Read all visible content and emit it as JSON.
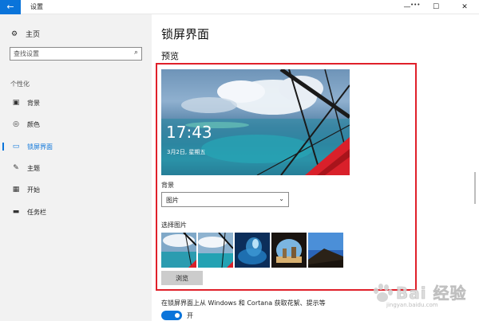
{
  "window": {
    "title": "设置",
    "back_icon": "back-arrow-icon",
    "controls": {
      "minimize": "—",
      "maximize": "☐",
      "close": "✕",
      "extra": "•••"
    }
  },
  "sidebar": {
    "home": {
      "label": "主页",
      "icon": "gear-icon"
    },
    "search": {
      "placeholder": "查找设置",
      "icon": "search-icon"
    },
    "section": "个性化",
    "items": [
      {
        "label": "背景",
        "icon": "image-icon",
        "active": false
      },
      {
        "label": "颜色",
        "icon": "palette-icon",
        "active": false
      },
      {
        "label": "锁屏界面",
        "icon": "lock-screen-icon",
        "active": true
      },
      {
        "label": "主题",
        "icon": "brush-icon",
        "active": false
      },
      {
        "label": "开始",
        "icon": "start-icon",
        "active": false
      },
      {
        "label": "任务栏",
        "icon": "taskbar-icon",
        "active": false
      }
    ]
  },
  "main": {
    "title": "锁屏界面",
    "preview_label": "预览",
    "lock_time": "17:43",
    "lock_date": "3月2日, 星期五",
    "background": {
      "label": "背景",
      "selected": "图片"
    },
    "choose_label": "选择图片",
    "browse_label": "浏览",
    "cortana_text": "在锁屏界面上从 Windows 和 Cortana 获取花絮、提示等",
    "toggle": {
      "state": "开",
      "on": true
    }
  },
  "watermark": {
    "text": "Bai 经验",
    "url": "jingyan.baidu.com"
  },
  "colors": {
    "accent": "#0a74da",
    "highlight": "#e0202a",
    "sidebar_bg": "#f2f2f2"
  }
}
